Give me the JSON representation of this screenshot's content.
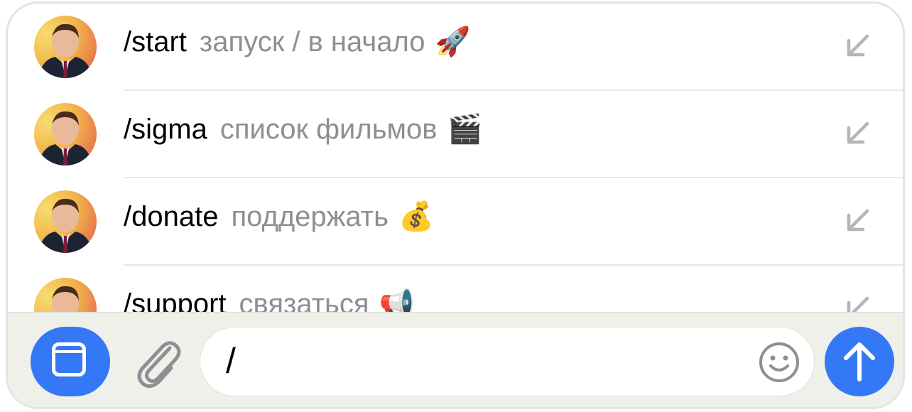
{
  "commands": [
    {
      "command": "/start",
      "description": "запуск / в начало",
      "emoji": "🚀"
    },
    {
      "command": "/sigma",
      "description": "список фильмов",
      "emoji": "🎬"
    },
    {
      "command": "/donate",
      "description": "поддержать",
      "emoji": "💰"
    },
    {
      "command": "/support",
      "description": "связаться",
      "emoji": "📢"
    }
  ],
  "composer": {
    "input_value": "/",
    "menu_icon": "bot-menu-icon",
    "attach_icon": "paperclip-icon",
    "emoji_icon": "smiley-icon",
    "send_icon": "arrow-up-icon"
  },
  "colors": {
    "accent": "#3478f6",
    "secondary_text": "#8e8e93",
    "composer_bg": "#eff0e9"
  }
}
